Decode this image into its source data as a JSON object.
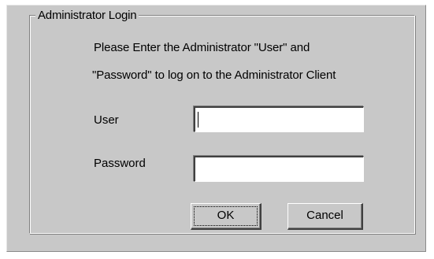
{
  "dialog": {
    "group_title": "Administrator Login",
    "message_line1": "Please Enter the  Administrator \"User\"  and",
    "message_line2": "\"Password\" to log on to the Administrator Client"
  },
  "fields": {
    "user_label": "User",
    "user_value": "",
    "password_label": "Password",
    "password_value": ""
  },
  "buttons": {
    "ok_label": "OK",
    "cancel_label": "Cancel"
  },
  "colors": {
    "dialog_bg": "#c8c8c8",
    "field_bg": "#ffffff"
  }
}
